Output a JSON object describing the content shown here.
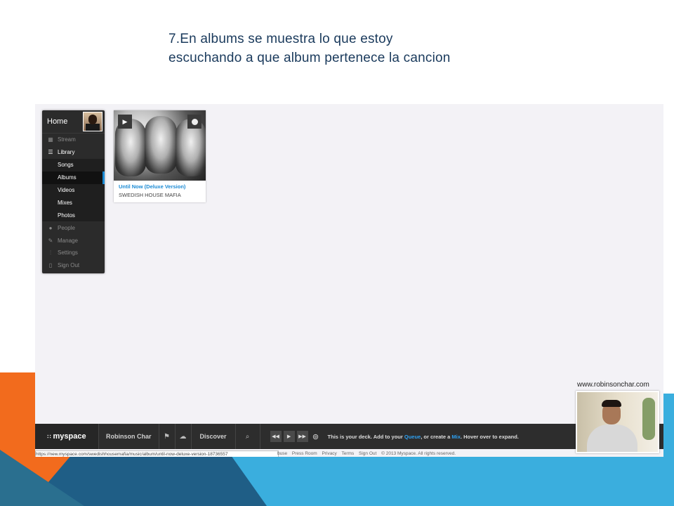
{
  "slide": {
    "title": "7.En albums se muestra lo que estoy escuchando a que album pertenece la cancion",
    "site_url": "www.robinsonchar.com"
  },
  "sidebar": {
    "home_label": "Home",
    "items": [
      {
        "label": "Stream",
        "icon": "stream-icon"
      },
      {
        "label": "Library",
        "icon": "library-icon"
      },
      {
        "label": "People",
        "icon": "people-icon"
      },
      {
        "label": "Manage",
        "icon": "wrench-icon"
      },
      {
        "label": "Settings",
        "icon": "sliders-icon"
      },
      {
        "label": "Sign Out",
        "icon": "signout-icon"
      }
    ],
    "library_sub": [
      "Songs",
      "Albums",
      "Videos",
      "Mixes",
      "Photos"
    ],
    "selected": "Albums"
  },
  "album": {
    "title": "Until Now (Deluxe Version)",
    "artist": "SWEDISH HOUSE MAFIA"
  },
  "deck": {
    "logo": "myspace",
    "user": "Robinson Char",
    "discover": "Discover",
    "msg_prefix": "This is your deck. Add to your ",
    "msg_queue": "Queue",
    "msg_mid": ", or create a ",
    "msg_mix": "Mix",
    "msg_suffix": ". Hover over to expand."
  },
  "status_url": "https://new.myspace.com/swedishhousemafia/music/album/until-now-deluxe-version-18736557",
  "footer": {
    "links": [
      "buse",
      "Press Room",
      "Privacy",
      "Terms",
      "Sign Out"
    ],
    "copyright": "© 2013 Myspace. All rights reserved."
  },
  "colors": {
    "accent_blue": "#1a8ad4",
    "orange": "#f26b1d",
    "slide_blue": "#2fa9d9"
  }
}
